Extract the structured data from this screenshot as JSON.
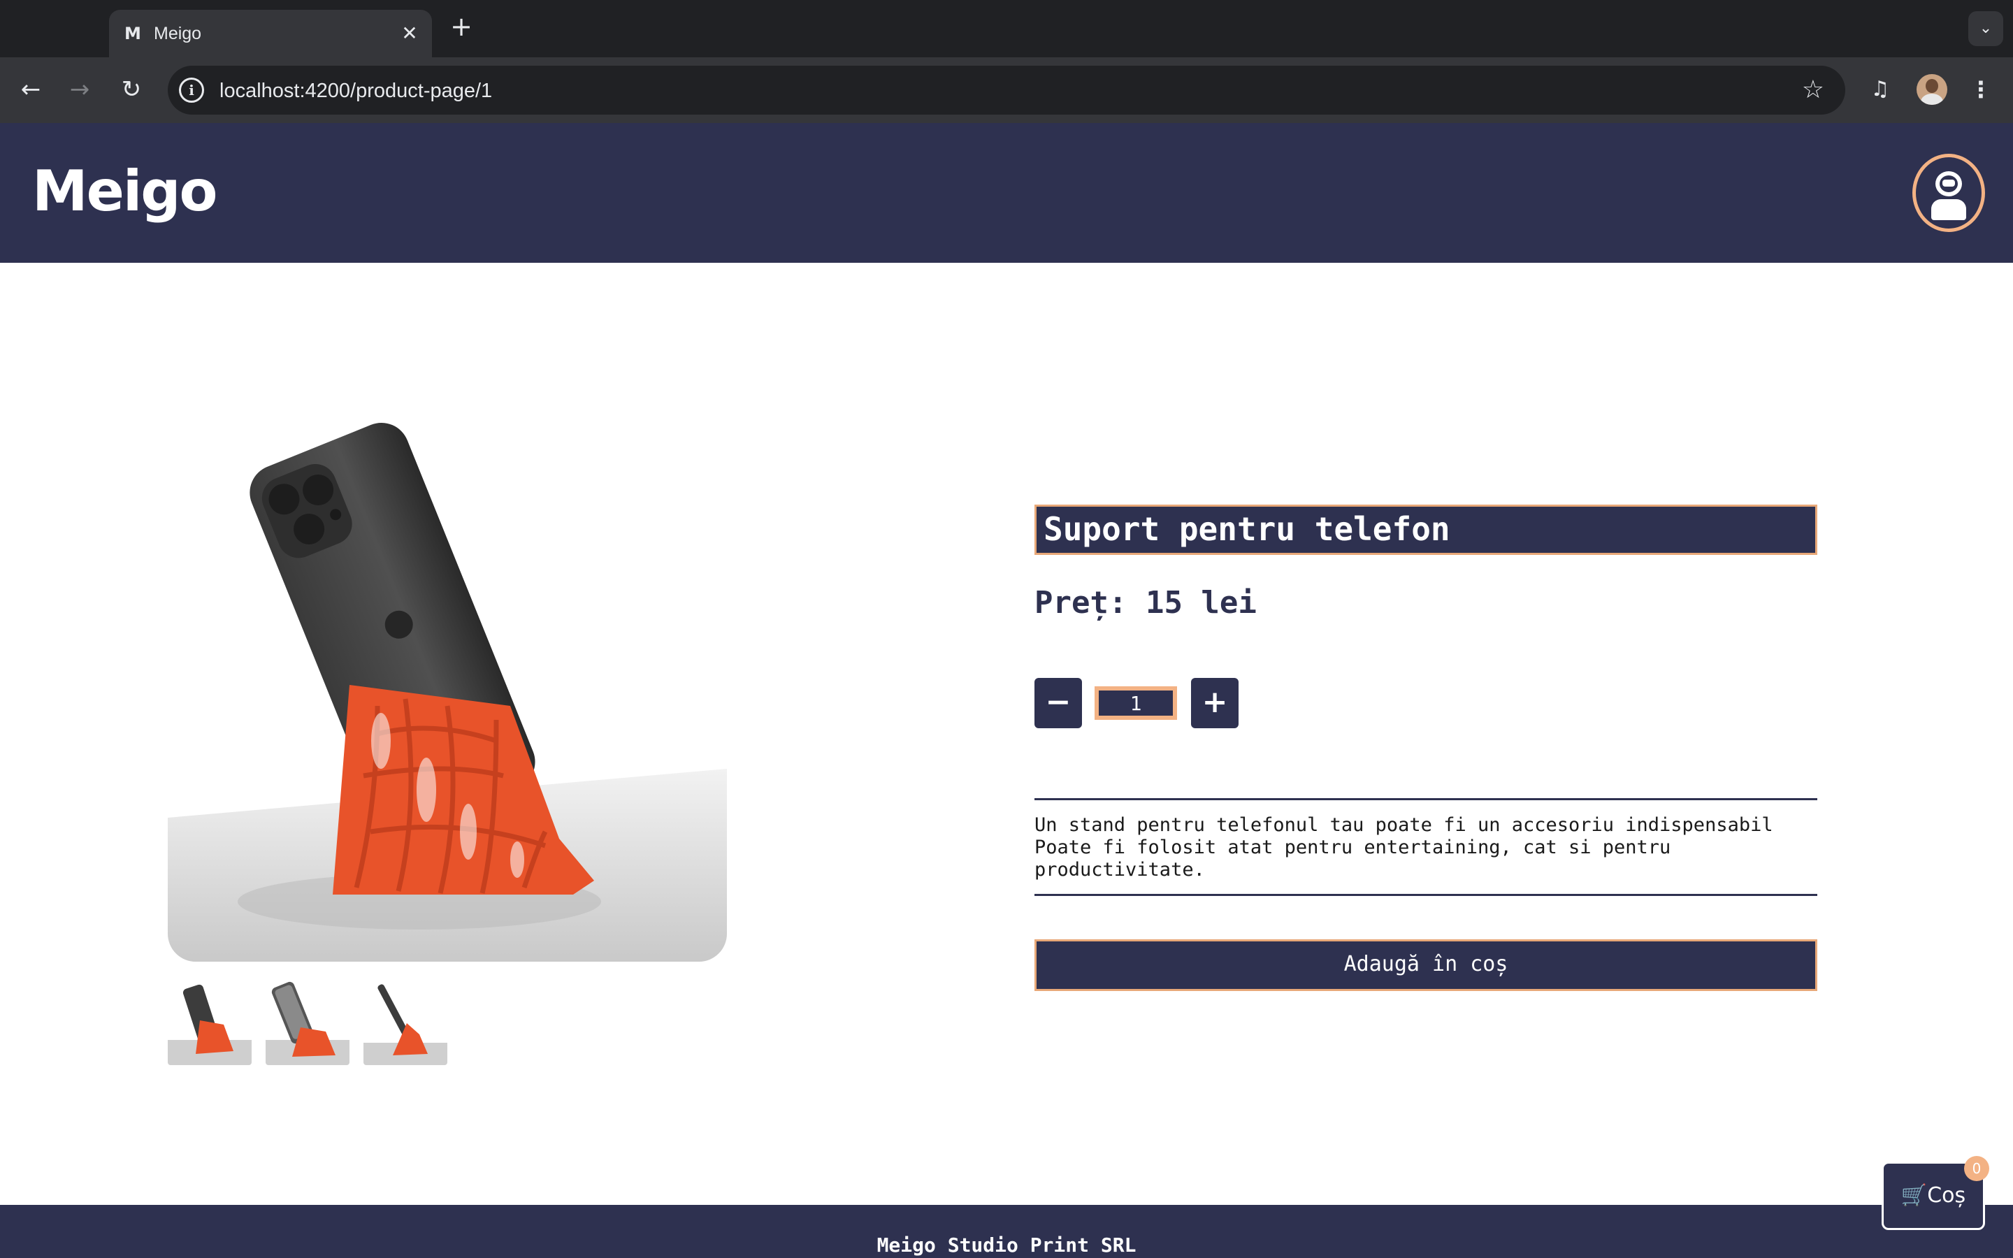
{
  "browser": {
    "tab_title": "Meigo",
    "favicon_letter": "M",
    "url": "localhost:4200/product-page/1",
    "icons": [
      "back-icon",
      "forward-icon",
      "reload-icon",
      "site-info-icon",
      "bookmark-star-icon",
      "media-control-icon",
      "profile-avatar",
      "kebab-menu-icon",
      "tab-close-icon",
      "new-tab-icon",
      "tab-search-icon"
    ]
  },
  "header": {
    "logo": "Meigo",
    "user_icon": "astronaut-user-icon"
  },
  "product": {
    "title": "Suport pentru telefon",
    "price_label": "Preț:",
    "price_value": "15 lei",
    "quantity": "1",
    "minus_label": "−",
    "plus_label": "+",
    "description": [
      "Un stand pentru telefonul tau poate fi un accesoriu indispensabil",
      "Poate fi folosit atat pentru entertaining, cat si pentru",
      "productivitate."
    ],
    "add_to_cart": "Adaugă în coș",
    "colors": {
      "navy": "#2e3150",
      "accent": "#f3b284",
      "stand": "#e8532a"
    }
  },
  "cart": {
    "label": "Coș",
    "count": "0"
  },
  "footer": {
    "company": "Meigo Studio Print SRL"
  }
}
